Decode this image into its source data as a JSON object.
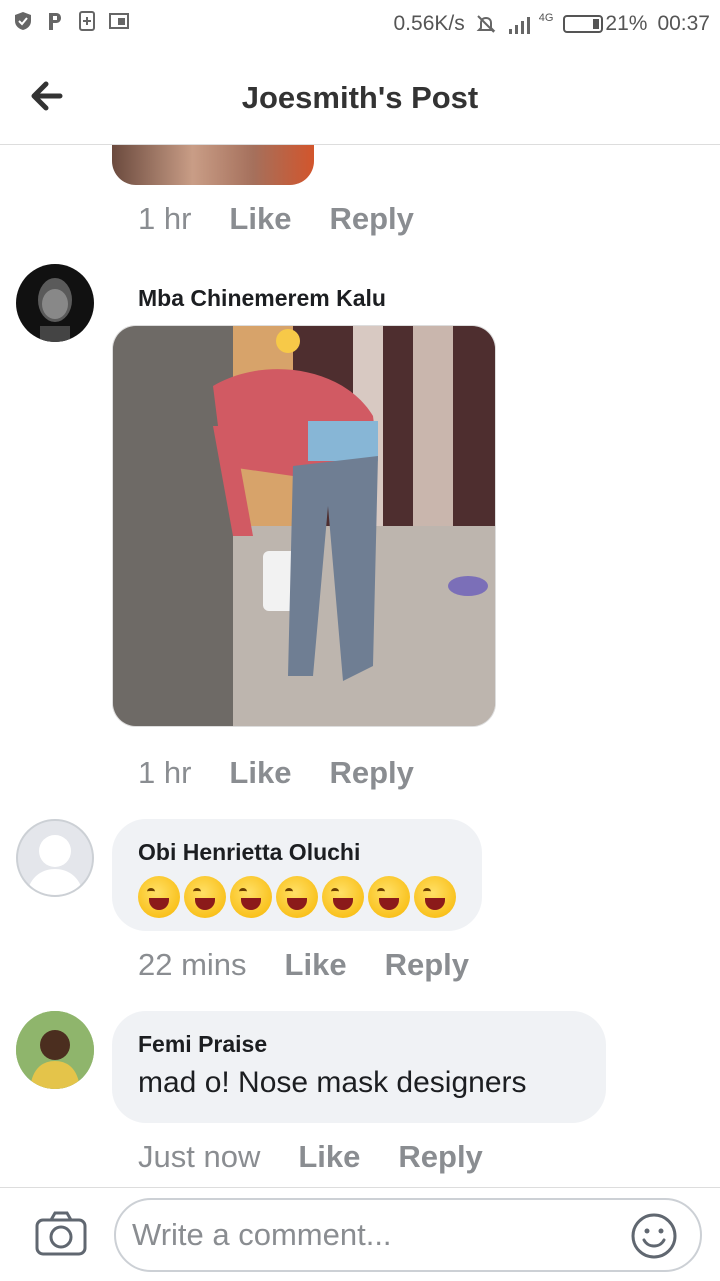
{
  "status_bar": {
    "network_speed": "0.56K/s",
    "signal_label": "4G",
    "battery": "21%",
    "time": "00:37",
    "left_icons": [
      "shield-icon",
      "p-icon",
      "sim-plus-icon",
      "screenshot-icon"
    ]
  },
  "header": {
    "title": "Joesmith's Post",
    "back_icon": "arrow-left-icon"
  },
  "comments": [
    {
      "time": "1 hr",
      "like": "Like",
      "reply": "Reply"
    },
    {
      "author": "Mba Chinemerem Kalu",
      "time": "1 hr",
      "like": "Like",
      "reply": "Reply"
    },
    {
      "author": "Obi Henrietta Oluchi",
      "emoji_count": 7,
      "emoji_icon": "laughing-emoji-icon",
      "time": "22 mins",
      "like": "Like",
      "reply": "Reply"
    },
    {
      "author": "Femi Praise",
      "text": "mad o! Nose mask designers",
      "time": "Just now",
      "like": "Like",
      "reply": "Reply"
    }
  ],
  "composer": {
    "placeholder": "Write a comment...",
    "camera_icon": "camera-icon",
    "emoji_icon": "smiley-icon"
  },
  "colors": {
    "meta_text": "#8a8d91",
    "bubble": "#f0f2f5",
    "title": "#333333"
  }
}
